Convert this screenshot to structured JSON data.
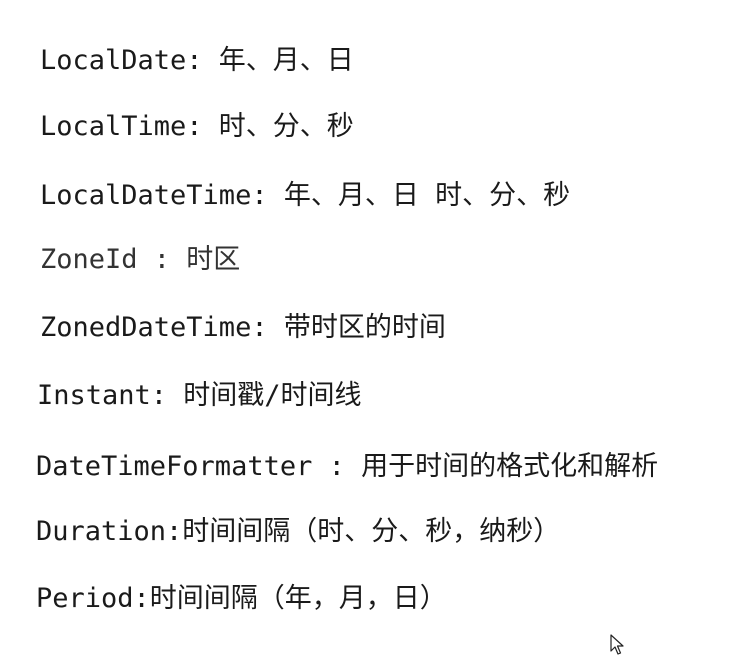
{
  "lines": [
    "LocalDate: 年、月、日",
    "LocalTime: 时、分、秒",
    "LocalDateTime:  年、月、日   时、分、秒",
    "ZoneId : 时区",
    "ZonedDateTime: 带时区的时间",
    "Instant: 时间戳/时间线",
    "DateTimeFormatter : 用于时间的格式化和解析",
    "Duration:时间间隔（时、分、秒，纳秒）",
    "Period:时间间隔（年，月，日）"
  ],
  "cursor_icon": "mouse-pointer-icon"
}
